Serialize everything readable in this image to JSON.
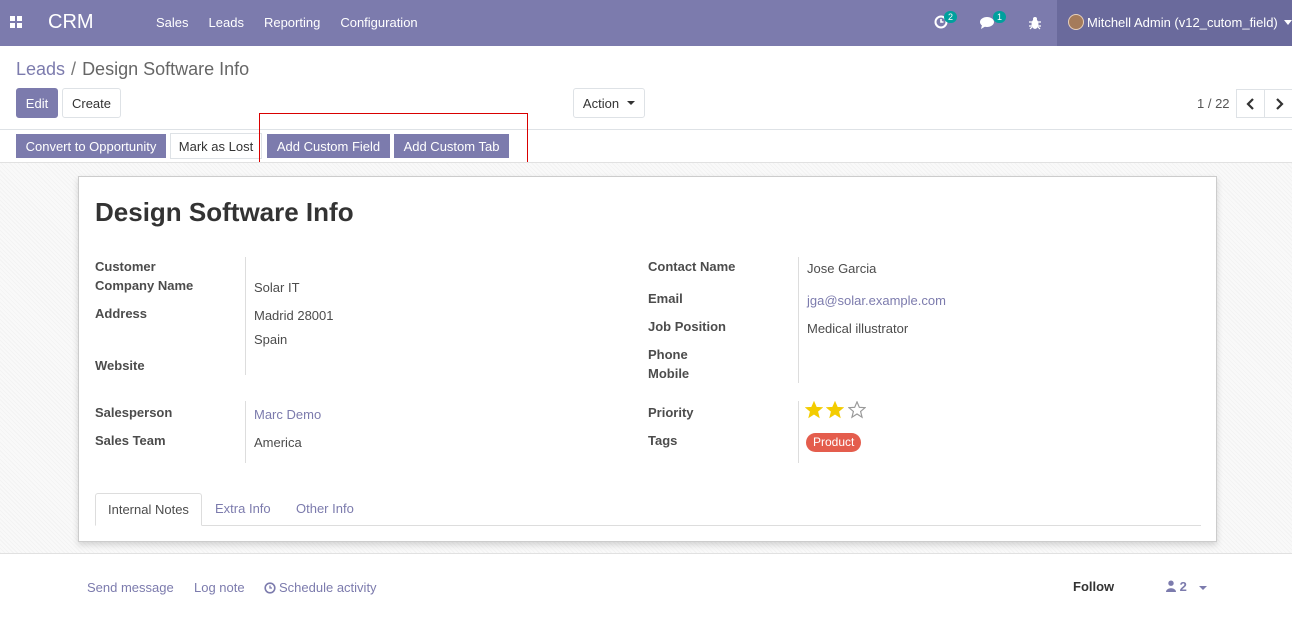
{
  "navbar": {
    "app_name": "CRM",
    "menu": [
      "Sales",
      "Leads",
      "Reporting",
      "Configuration"
    ],
    "activities_badge": "2",
    "messages_badge": "1",
    "user_name": "Mitchell Admin (v12_cutom_field)",
    "accent": "#7c7bad"
  },
  "breadcrumb": {
    "parent": "Leads",
    "separator": "/",
    "current": "Design Software Info"
  },
  "buttons": {
    "edit": "Edit",
    "create": "Create",
    "action": "Action"
  },
  "pager": {
    "value": "1 / 22"
  },
  "statusbar": {
    "convert": "Convert to Opportunity",
    "mark_lost": "Mark as Lost",
    "add_field": "Add Custom Field",
    "add_tab": "Add Custom Tab"
  },
  "form": {
    "title": "Design Software Info",
    "left": {
      "customer_label": "Customer",
      "company_label": "Company Name",
      "company_value": "Solar IT",
      "address_label": "Address",
      "address_line1": "Madrid  28001",
      "address_line2": "Spain",
      "website_label": "Website",
      "salesperson_label": "Salesperson",
      "salesperson_value": "Marc Demo",
      "team_label": "Sales Team",
      "team_value": "America"
    },
    "right": {
      "contact_label": "Contact Name",
      "contact_value": "Jose Garcia",
      "email_label": "Email",
      "email_value": "jga@solar.example.com",
      "job_label": "Job Position",
      "job_value": "Medical illustrator",
      "phone_label": "Phone",
      "mobile_label": "Mobile",
      "priority_label": "Priority",
      "priority_value": 2,
      "priority_max": 3,
      "tags_label": "Tags",
      "tag_value": "Product",
      "tag_color": "#e45d4d"
    },
    "tabs": [
      "Internal Notes",
      "Extra Info",
      "Other Info"
    ]
  },
  "chatter": {
    "send_message": "Send message",
    "log_note": "Log note",
    "schedule": "Schedule activity",
    "follow": "Follow",
    "followers_count": "2"
  }
}
